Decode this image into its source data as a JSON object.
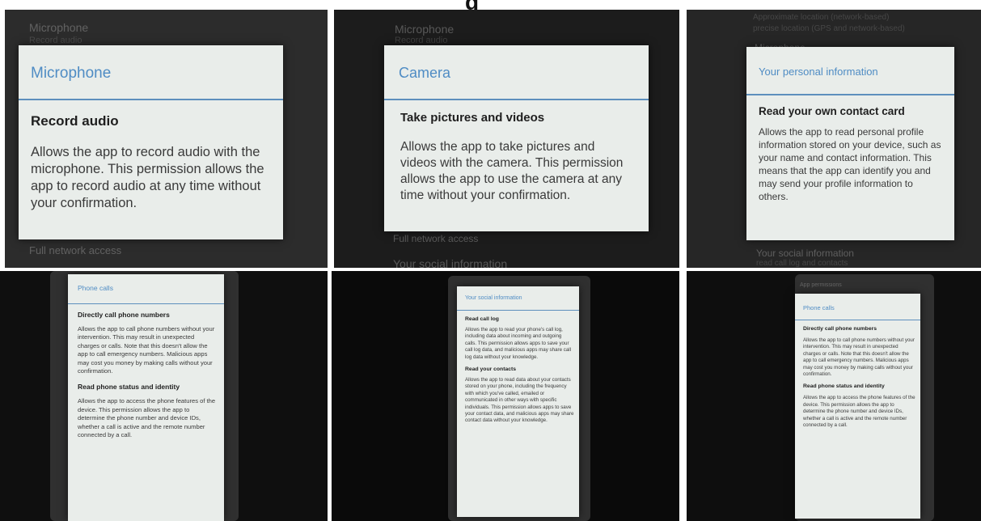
{
  "header": {
    "partial_title": "g"
  },
  "panels": [
    {
      "bg_top": "Microphone",
      "bg_top_sub": "Record audio",
      "dialog": {
        "title": "Microphone",
        "permissions": [
          {
            "heading": "Record audio",
            "text": "Allows the app to record audio with the microphone. This permission allows the app to record audio at any time without your confirmation."
          }
        ]
      },
      "bg_bottom": "Full network access"
    },
    {
      "bg_top": "Microphone",
      "bg_top_sub": "Record audio",
      "dialog": {
        "title": "Camera",
        "permissions": [
          {
            "heading": "Take pictures and videos",
            "text": "Allows the app to take pictures and videos with the camera. This permission allows the app to use the camera at any time without your confirmation."
          }
        ]
      },
      "bg_bottom": "Full network access",
      "bg_bottom2": "Your social information"
    },
    {
      "bg_top": "Approximate location (network-based)",
      "bg_top_sub": "precise location (GPS and network-based)",
      "bg_mid": "Microphone",
      "dialog": {
        "title": "Your personal information",
        "permissions": [
          {
            "heading": "Read your own contact card",
            "text": "Allows the app to read personal profile information stored on your device, such as your name and contact information. This means that the app can identify you and may send your profile information to others."
          }
        ]
      },
      "bg_bottom": "Your social information",
      "bg_bottom_sub": "read call log and contacts"
    },
    {
      "dialog": {
        "title": "Phone calls",
        "permissions": [
          {
            "heading": "Directly call phone numbers",
            "text": "Allows the app to call phone numbers without your intervention. This may result in unexpected charges or calls. Note that this doesn't allow the app to call emergency numbers. Malicious apps may cost you money by making calls without your confirmation."
          },
          {
            "heading": "Read phone status and identity",
            "text": "Allows the app to access the phone features of the device. This permission allows the app to determine the phone number and device IDs, whether a call is active and the remote number connected by a call."
          }
        ]
      }
    },
    {
      "dialog": {
        "title": "Your social information",
        "permissions": [
          {
            "heading": "Read call log",
            "text": "Allows the app to read your phone's call log, including data about incoming and outgoing calls. This permission allows apps to save your call log data, and malicious apps may share call log data without your knowledge."
          },
          {
            "heading": "Read your contacts",
            "text": "Allows the app to read data about your contacts stored on your phone, including the frequency with which you've called, emailed or communicated in other ways with specific individuals. This permission allows apps to save your contact data, and malicious apps may share contact data without your knowledge."
          }
        ]
      }
    },
    {
      "bg_top": "App permissions",
      "dialog": {
        "title": "Phone calls",
        "permissions": [
          {
            "heading": "Directly call phone numbers",
            "text": "Allows the app to call phone numbers without your intervention. This may result in unexpected charges or calls. Note that this doesn't allow the app to call emergency numbers. Malicious apps may cost you money by making calls without your confirmation."
          },
          {
            "heading": "Read phone status and identity",
            "text": "Allows the app to access the phone features of the device. This permission allows the app to determine the phone number and device IDs, whether a call is active and the remote number connected by a call."
          }
        ]
      }
    }
  ]
}
